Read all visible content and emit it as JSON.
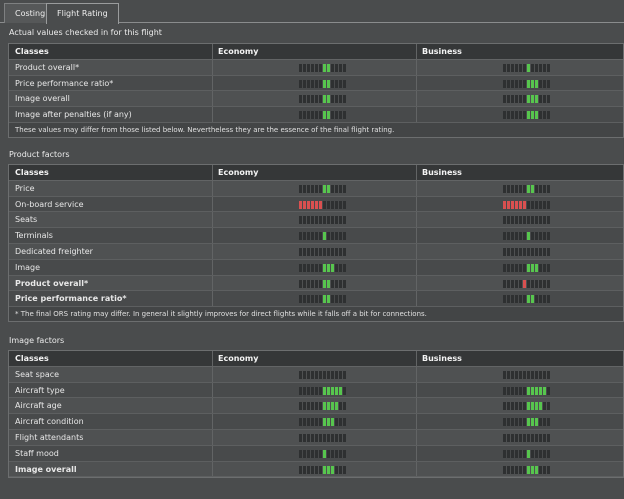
{
  "tabs": [
    {
      "label": "Costing",
      "active": false
    },
    {
      "label": "Flight Rating",
      "active": true
    }
  ],
  "colors": {
    "good": "#57c64e",
    "bad": "#d95050",
    "empty": "#2e3031"
  },
  "meter_segments": 12,
  "sections": [
    {
      "title": "Actual values checked in for this flight",
      "headers": [
        "Classes",
        "Economy",
        "Business"
      ],
      "rows": [
        {
          "label": "Product overall*",
          "bold": false,
          "economy": {
            "filled": [
              6,
              7
            ],
            "color": "green"
          },
          "business": {
            "filled": [
              6
            ],
            "color": "green"
          }
        },
        {
          "label": "Price performance ratio*",
          "bold": false,
          "economy": {
            "filled": [
              6,
              7
            ],
            "color": "green"
          },
          "business": {
            "filled": [
              6,
              7,
              8
            ],
            "color": "green"
          }
        },
        {
          "label": "Image overall",
          "bold": false,
          "economy": {
            "filled": [
              6,
              7
            ],
            "color": "green"
          },
          "business": {
            "filled": [
              6,
              7,
              8
            ],
            "color": "green"
          }
        },
        {
          "label": "Image after penalties (if any)",
          "bold": false,
          "economy": {
            "filled": [
              6,
              7
            ],
            "color": "green"
          },
          "business": {
            "filled": [
              6,
              7,
              8
            ],
            "color": "green"
          }
        }
      ],
      "note": "These values may differ from those listed below. Nevertheless they are the essence of the final flight rating."
    },
    {
      "title": "Product factors",
      "headers": [
        "Classes",
        "Economy",
        "Business"
      ],
      "rows": [
        {
          "label": "Price",
          "bold": false,
          "economy": {
            "filled": [
              6,
              7
            ],
            "color": "green"
          },
          "business": {
            "filled": [
              6,
              7
            ],
            "color": "green"
          }
        },
        {
          "label": "On-board service",
          "bold": false,
          "economy": {
            "filled": [
              0,
              1,
              2,
              3,
              4,
              5
            ],
            "color": "red"
          },
          "business": {
            "filled": [
              0,
              1,
              2,
              3,
              4,
              5
            ],
            "color": "red"
          }
        },
        {
          "label": "Seats",
          "bold": false,
          "economy": {
            "filled": [],
            "color": "green"
          },
          "business": {
            "filled": [],
            "color": "green"
          }
        },
        {
          "label": "Terminals",
          "bold": false,
          "economy": {
            "filled": [
              6
            ],
            "color": "green"
          },
          "business": {
            "filled": [
              6
            ],
            "color": "green"
          }
        },
        {
          "label": "Dedicated freighter",
          "bold": false,
          "economy": {
            "filled": [],
            "color": "green"
          },
          "business": {
            "filled": [],
            "color": "green"
          }
        },
        {
          "label": "Image",
          "bold": false,
          "economy": {
            "filled": [
              6,
              7,
              8
            ],
            "color": "green"
          },
          "business": {
            "filled": [
              6,
              7,
              8
            ],
            "color": "green"
          }
        },
        {
          "label": "Product overall*",
          "bold": true,
          "economy": {
            "filled": [
              6,
              7
            ],
            "color": "green"
          },
          "business": {
            "filled": [
              5
            ],
            "color": "red"
          }
        },
        {
          "label": "Price performance ratio*",
          "bold": true,
          "economy": {
            "filled": [
              6,
              7
            ],
            "color": "green"
          },
          "business": {
            "filled": [
              6,
              7
            ],
            "color": "green"
          }
        }
      ],
      "note": "* The final ORS rating may differ. In general it slightly improves for direct flights while it falls off a bit for connections."
    },
    {
      "title": "Image factors",
      "headers": [
        "Classes",
        "Economy",
        "Business"
      ],
      "rows": [
        {
          "label": "Seat space",
          "bold": false,
          "economy": {
            "filled": [],
            "color": "green"
          },
          "business": {
            "filled": [],
            "color": "green"
          }
        },
        {
          "label": "Aircraft type",
          "bold": false,
          "economy": {
            "filled": [
              6,
              7,
              8,
              9,
              10
            ],
            "color": "green"
          },
          "business": {
            "filled": [
              6,
              7,
              8,
              9,
              10
            ],
            "color": "green"
          }
        },
        {
          "label": "Aircraft age",
          "bold": false,
          "economy": {
            "filled": [
              6,
              7,
              8,
              9
            ],
            "color": "green"
          },
          "business": {
            "filled": [
              6,
              7,
              8,
              9
            ],
            "color": "green"
          }
        },
        {
          "label": "Aircraft condition",
          "bold": false,
          "economy": {
            "filled": [
              6,
              7,
              8
            ],
            "color": "green"
          },
          "business": {
            "filled": [
              6,
              7,
              8
            ],
            "color": "green"
          }
        },
        {
          "label": "Flight attendants",
          "bold": false,
          "economy": {
            "filled": [],
            "color": "green"
          },
          "business": {
            "filled": [],
            "color": "green"
          }
        },
        {
          "label": "Staff mood",
          "bold": false,
          "economy": {
            "filled": [
              6
            ],
            "color": "green"
          },
          "business": {
            "filled": [
              6
            ],
            "color": "green"
          }
        },
        {
          "label": "Image overall",
          "bold": true,
          "economy": {
            "filled": [
              6,
              7,
              8
            ],
            "color": "green"
          },
          "business": {
            "filled": [
              6,
              7,
              8
            ],
            "color": "green"
          }
        }
      ],
      "note": ""
    }
  ]
}
